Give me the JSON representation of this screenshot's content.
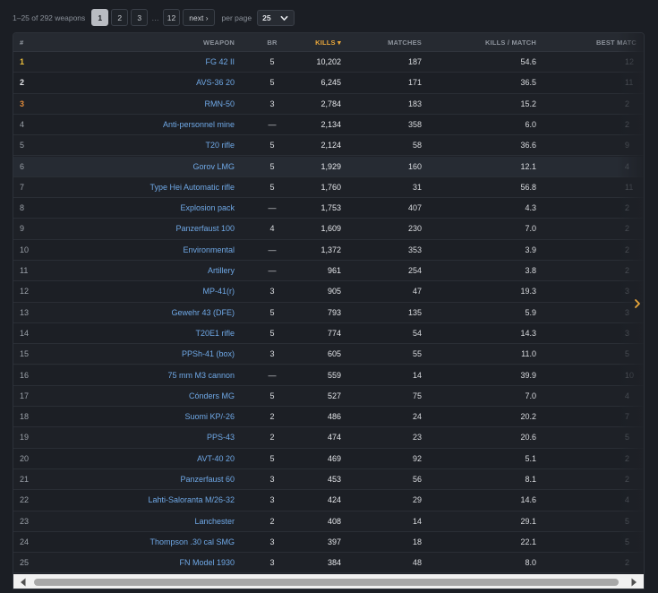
{
  "pagination": {
    "summary": "1–25 of 292 weapons",
    "pages": [
      "1",
      "2",
      "3"
    ],
    "ellipsis": "…",
    "last_page": "12",
    "next_label": "next ›",
    "per_page_label": "per page",
    "per_page_value": "25",
    "active_page": "1"
  },
  "table": {
    "columns": {
      "rank": "#",
      "weapon": "WEAPON",
      "br": "BR",
      "kills": "KILLS ▾",
      "matches": "MATCHES",
      "kpm": "KILLS / MATCH",
      "best": "BEST MATC"
    },
    "rows": [
      {
        "rank": "1",
        "weapon": "FG 42 II",
        "br": "5",
        "kills": "10,202",
        "matches": "187",
        "kpm": "54.6",
        "best": "12"
      },
      {
        "rank": "2",
        "weapon": "AVS-36 20",
        "br": "5",
        "kills": "6,245",
        "matches": "171",
        "kpm": "36.5",
        "best": "11"
      },
      {
        "rank": "3",
        "weapon": "RMN-50",
        "br": "3",
        "kills": "2,784",
        "matches": "183",
        "kpm": "15.2",
        "best": "2"
      },
      {
        "rank": "4",
        "weapon": "Anti-personnel mine",
        "br": "—",
        "kills": "2,134",
        "matches": "358",
        "kpm": "6.0",
        "best": "2"
      },
      {
        "rank": "5",
        "weapon": "T20 rifle",
        "br": "5",
        "kills": "2,124",
        "matches": "58",
        "kpm": "36.6",
        "best": "9"
      },
      {
        "rank": "6",
        "weapon": "Gorov LMG",
        "br": "5",
        "kills": "1,929",
        "matches": "160",
        "kpm": "12.1",
        "best": "4"
      },
      {
        "rank": "7",
        "weapon": "Type Hei Automatic rifle",
        "br": "5",
        "kills": "1,760",
        "matches": "31",
        "kpm": "56.8",
        "best": "11"
      },
      {
        "rank": "8",
        "weapon": "Explosion pack",
        "br": "—",
        "kills": "1,753",
        "matches": "407",
        "kpm": "4.3",
        "best": "2"
      },
      {
        "rank": "9",
        "weapon": "Panzerfaust 100",
        "br": "4",
        "kills": "1,609",
        "matches": "230",
        "kpm": "7.0",
        "best": "2"
      },
      {
        "rank": "10",
        "weapon": "Environmental",
        "br": "—",
        "kills": "1,372",
        "matches": "353",
        "kpm": "3.9",
        "best": "2"
      },
      {
        "rank": "11",
        "weapon": "Artillery",
        "br": "—",
        "kills": "961",
        "matches": "254",
        "kpm": "3.8",
        "best": "2"
      },
      {
        "rank": "12",
        "weapon": "MP-41(r)",
        "br": "3",
        "kills": "905",
        "matches": "47",
        "kpm": "19.3",
        "best": "3"
      },
      {
        "rank": "13",
        "weapon": "Gewehr 43 (DFE)",
        "br": "5",
        "kills": "793",
        "matches": "135",
        "kpm": "5.9",
        "best": "3"
      },
      {
        "rank": "14",
        "weapon": "T20E1 rifle",
        "br": "5",
        "kills": "774",
        "matches": "54",
        "kpm": "14.3",
        "best": "3"
      },
      {
        "rank": "15",
        "weapon": "PPSh-41 (box)",
        "br": "3",
        "kills": "605",
        "matches": "55",
        "kpm": "11.0",
        "best": "5"
      },
      {
        "rank": "16",
        "weapon": "75 mm M3 cannon",
        "br": "—",
        "kills": "559",
        "matches": "14",
        "kpm": "39.9",
        "best": "10"
      },
      {
        "rank": "17",
        "weapon": "Cónders MG",
        "br": "5",
        "kills": "527",
        "matches": "75",
        "kpm": "7.0",
        "best": "4"
      },
      {
        "rank": "18",
        "weapon": "Suomi KP/-26",
        "br": "2",
        "kills": "486",
        "matches": "24",
        "kpm": "20.2",
        "best": "7"
      },
      {
        "rank": "19",
        "weapon": "PPS-43",
        "br": "2",
        "kills": "474",
        "matches": "23",
        "kpm": "20.6",
        "best": "5"
      },
      {
        "rank": "20",
        "weapon": "AVT-40 20",
        "br": "5",
        "kills": "469",
        "matches": "92",
        "kpm": "5.1",
        "best": "2"
      },
      {
        "rank": "21",
        "weapon": "Panzerfaust 60",
        "br": "3",
        "kills": "453",
        "matches": "56",
        "kpm": "8.1",
        "best": "2"
      },
      {
        "rank": "22",
        "weapon": "Lahti-Saloranta M/26-32",
        "br": "3",
        "kills": "424",
        "matches": "29",
        "kpm": "14.6",
        "best": "4"
      },
      {
        "rank": "23",
        "weapon": "Lanchester",
        "br": "2",
        "kills": "408",
        "matches": "14",
        "kpm": "29.1",
        "best": "5"
      },
      {
        "rank": "24",
        "weapon": "Thompson .30 cal SMG",
        "br": "3",
        "kills": "397",
        "matches": "18",
        "kpm": "22.1",
        "best": "5"
      },
      {
        "rank": "25",
        "weapon": "FN Model 1930",
        "br": "3",
        "kills": "384",
        "matches": "48",
        "kpm": "8.0",
        "best": "2"
      }
    ]
  },
  "colors": {
    "accent_sort": "#e8a63a",
    "link": "#6fa8e6",
    "rank_gold": "#f0c23c",
    "rank_bronze": "#e08a3a"
  },
  "icons": {
    "per_page_toggle": "chevron-down-icon",
    "scroll_right_hint": "chevron-right-icon",
    "scroll_left": "triangle-left-icon",
    "scroll_right": "triangle-right-icon"
  }
}
